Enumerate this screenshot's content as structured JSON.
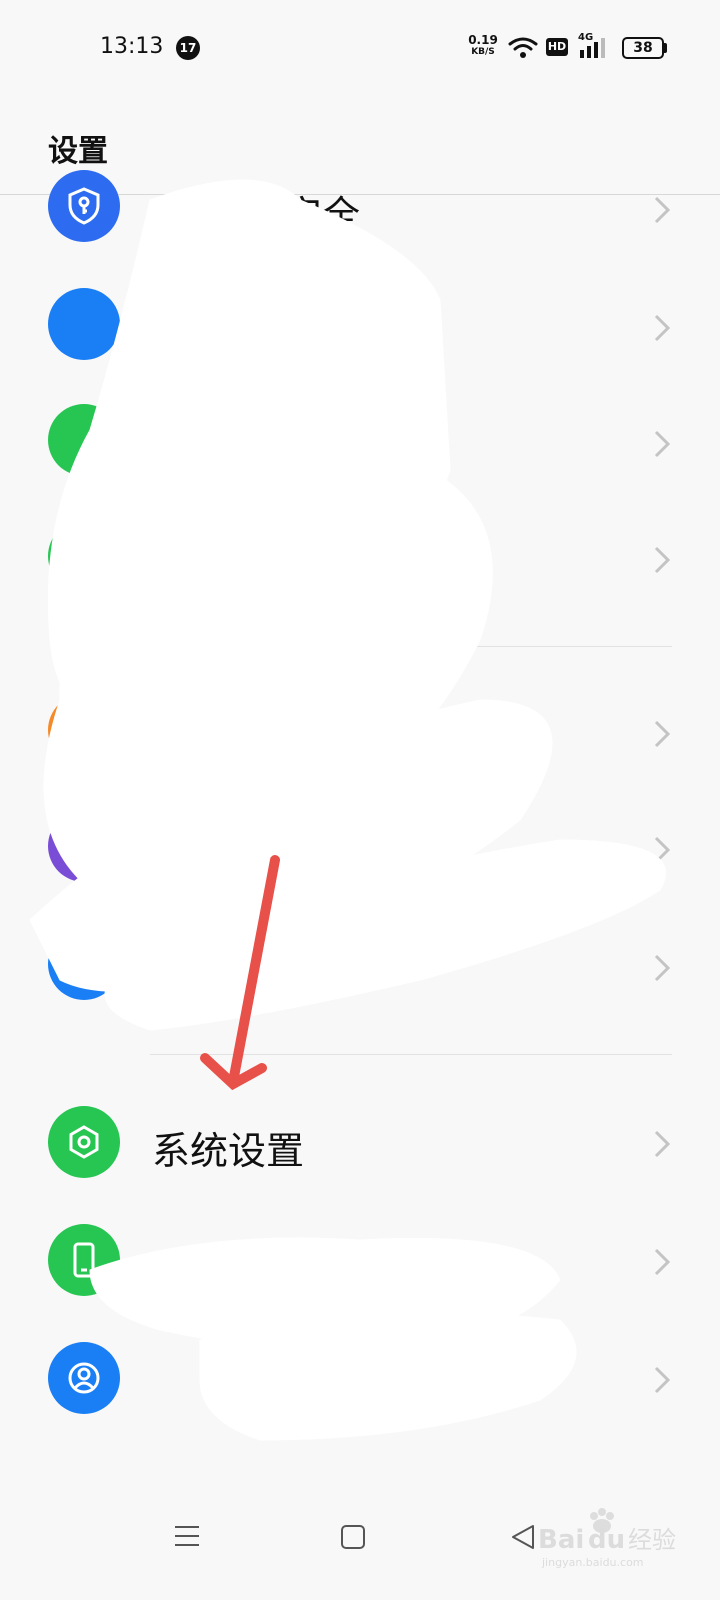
{
  "status_bar": {
    "time": "13:13",
    "notification_count": "17",
    "net_speed_value": "0.19",
    "net_speed_unit": "KB/S",
    "hd_label": "HD",
    "network_type": "4G",
    "battery_level": "38"
  },
  "header": {
    "title": "设置"
  },
  "list": {
    "items": [
      {
        "label": "安全",
        "icon": "shield-key-icon",
        "color": "#2d6cf0",
        "partially_obscured": true
      },
      {
        "label": "",
        "icon": "eye-icon",
        "color": "#1a7ff5",
        "partially_obscured": true
      },
      {
        "label": "",
        "icon": "circle-icon",
        "color": "#27c653",
        "partially_obscured": true
      },
      {
        "label": "",
        "icon": "circle-icon",
        "color": "#27c653",
        "partially_obscured": true
      },
      {
        "label": "",
        "icon": "circle-icon",
        "color": "#f58a2a",
        "partially_obscured": true
      },
      {
        "label": "",
        "icon": "circle-icon",
        "color": "#7a4dd6",
        "partially_obscured": true
      },
      {
        "label": "",
        "icon": "circle-icon",
        "color": "#1a7ff5",
        "partially_obscured": true
      },
      {
        "label": "系统设置",
        "icon": "hexagon-gear-icon",
        "color": "#27c653",
        "partially_obscured": false
      },
      {
        "label": "",
        "icon": "phone-icon",
        "color": "#27c653",
        "partially_obscured": true
      },
      {
        "label": "",
        "icon": "user-icon",
        "color": "#1a7ff5",
        "partially_obscured": true
      }
    ]
  },
  "annotation": {
    "arrow_color": "#e8504a"
  },
  "watermark": {
    "text": "Bai du 经验",
    "url_text": "jingyan.baidu.com"
  }
}
